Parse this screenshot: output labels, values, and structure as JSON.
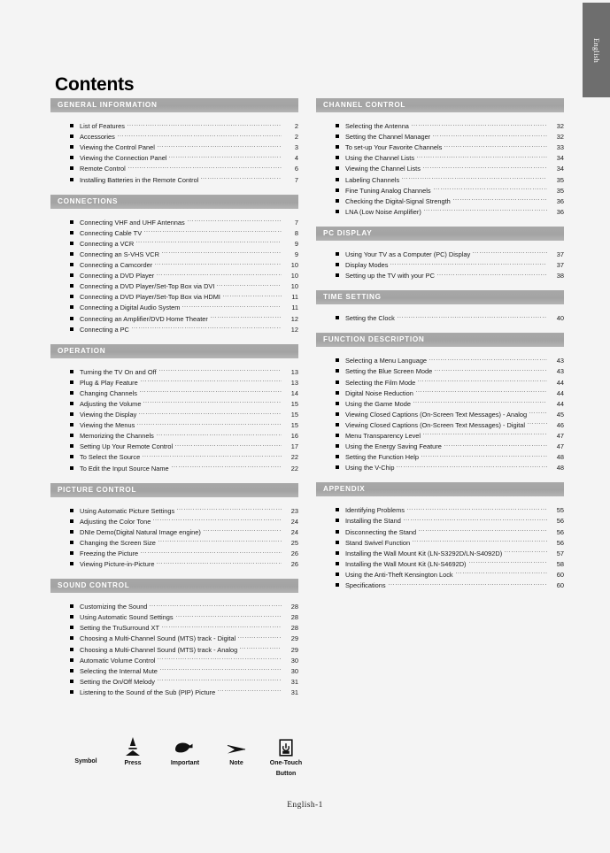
{
  "page": {
    "title": "Contents",
    "footer": "English-1",
    "side_tab_label": "English",
    "accent_header_color": "#a5a5a5",
    "header_text_color": "#ffffff",
    "background_color": "#f4f4f4"
  },
  "columns": {
    "left": [
      {
        "id": "general-information",
        "title": "GENERAL INFORMATION",
        "entries": [
          {
            "label": "List of Features",
            "page": "2"
          },
          {
            "label": "Accessories",
            "page": "2"
          },
          {
            "label": "Viewing the Control Panel",
            "page": "3"
          },
          {
            "label": "Viewing the Connection Panel",
            "page": "4"
          },
          {
            "label": "Remote Control",
            "page": "6"
          },
          {
            "label": "Installing Batteries in the Remote Control",
            "page": "7"
          }
        ]
      },
      {
        "id": "connections",
        "title": "CONNECTIONS",
        "entries": [
          {
            "label": "Connecting VHF and UHF Antennas",
            "page": "7"
          },
          {
            "label": "Connecting Cable TV",
            "page": "8"
          },
          {
            "label": "Connecting a VCR",
            "page": "9"
          },
          {
            "label": "Connecting an S-VHS VCR",
            "page": "9"
          },
          {
            "label": "Connecting a Camcorder",
            "page": "10"
          },
          {
            "label": "Connecting a DVD Player",
            "page": "10"
          },
          {
            "label": "Connecting a DVD Player/Set-Top Box via DVI",
            "page": "10"
          },
          {
            "label": "Connecting a DVD Player/Set-Top Box via HDMI",
            "page": "11"
          },
          {
            "label": "Connecting a Digital Audio System",
            "page": "11"
          },
          {
            "label": "Connecting an Amplifier/DVD Home Theater",
            "page": "12"
          },
          {
            "label": "Connecting a PC",
            "page": "12"
          }
        ]
      },
      {
        "id": "operation",
        "title": "OPERATION",
        "entries": [
          {
            "label": "Turning the TV On and Off",
            "page": "13"
          },
          {
            "label": "Plug & Play Feature",
            "page": "13"
          },
          {
            "label": "Changing Channels",
            "page": "14"
          },
          {
            "label": "Adjusting the Volume",
            "page": "15"
          },
          {
            "label": "Viewing the Display",
            "page": "15"
          },
          {
            "label": "Viewing the Menus",
            "page": "15"
          },
          {
            "label": "Memorizing the Channels",
            "page": "16"
          },
          {
            "label": "Setting Up Your Remote Control",
            "page": "17"
          },
          {
            "label": "To Select the Source",
            "page": "22"
          },
          {
            "label": "To Edit the Input Source Name",
            "page": "22"
          }
        ]
      },
      {
        "id": "picture-control",
        "title": "PICTURE CONTROL",
        "entries": [
          {
            "label": "Using Automatic Picture Settings",
            "page": "23"
          },
          {
            "label": "Adjusting the Color Tone",
            "page": "24"
          },
          {
            "label": "DNIe Demo(Digital Natural Image engine)",
            "page": "24"
          },
          {
            "label": "Changing the Screen Size",
            "page": "25"
          },
          {
            "label": "Freezing the Picture",
            "page": "26"
          },
          {
            "label": "Viewing Picture-in-Picture",
            "page": "26"
          }
        ]
      },
      {
        "id": "sound-control",
        "title": "SOUND CONTROL",
        "entries": [
          {
            "label": "Customizing the Sound",
            "page": "28"
          },
          {
            "label": "Using Automatic Sound Settings",
            "page": "28"
          },
          {
            "label": "Setting the TruSurround XT",
            "page": "28"
          },
          {
            "label": "Choosing a Multi-Channel Sound (MTS) track - Digital",
            "page": "29"
          },
          {
            "label": "Choosing a Multi-Channel Sound (MTS) track - Analog",
            "page": "29"
          },
          {
            "label": "Automatic Volume Control",
            "page": "30"
          },
          {
            "label": "Selecting the Internal Mute",
            "page": "30"
          },
          {
            "label": "Setting the On/Off Melody",
            "page": "31"
          },
          {
            "label": "Listening to the Sound of the Sub (PIP) Picture",
            "page": "31"
          }
        ]
      }
    ],
    "right": [
      {
        "id": "channel-control",
        "title": "CHANNEL CONTROL",
        "entries": [
          {
            "label": "Selecting the Antenna",
            "page": "32"
          },
          {
            "label": "Setting the Channel Manager",
            "page": "32"
          },
          {
            "label": "To set-up Your Favorite Channels",
            "page": "33"
          },
          {
            "label": "Using the Channel Lists",
            "page": "34"
          },
          {
            "label": "Viewing the Channel Lists",
            "page": "34"
          },
          {
            "label": "Labeling Channels",
            "page": "35"
          },
          {
            "label": "Fine Tuning Analog Channels",
            "page": "35"
          },
          {
            "label": "Checking the Digital-Signal Strength",
            "page": "36"
          },
          {
            "label": "LNA (Low Noise Amplifier)",
            "page": "36"
          }
        ]
      },
      {
        "id": "pc-display",
        "title": "PC DISPLAY",
        "entries": [
          {
            "label": "Using Your TV as a Computer (PC) Display",
            "page": "37"
          },
          {
            "label": "Display Modes",
            "page": "37"
          },
          {
            "label": "Setting up the TV with your PC",
            "page": "38"
          }
        ]
      },
      {
        "id": "time-setting",
        "title": "TIME SETTING",
        "entries": [
          {
            "label": "Setting the Clock",
            "page": "40"
          }
        ]
      },
      {
        "id": "function-description",
        "title": "FUNCTION DESCRIPTION",
        "entries": [
          {
            "label": "Selecting a Menu Language",
            "page": "43"
          },
          {
            "label": "Setting the Blue Screen Mode",
            "page": "43"
          },
          {
            "label": "Selecting the Film Mode",
            "page": "44"
          },
          {
            "label": "Digital Noise Reduction",
            "page": "44"
          },
          {
            "label": "Using the Game Mode",
            "page": "44"
          },
          {
            "label": "Viewing Closed Captions (On-Screen Text Messages) - Analog",
            "page": "45"
          },
          {
            "label": "Viewing Closed Captions (On-Screen Text Messages) - Digital",
            "page": "46"
          },
          {
            "label": "Menu Transparency Level",
            "page": "47"
          },
          {
            "label": "Using the Energy Saving Feature",
            "page": "47"
          },
          {
            "label": "Setting the Function Help",
            "page": "48"
          },
          {
            "label": "Using the V-Chip",
            "page": "48"
          }
        ]
      },
      {
        "id": "appendix",
        "title": "APPENDIX",
        "entries": [
          {
            "label": "Identifying Problems",
            "page": "55"
          },
          {
            "label": "Installing the Stand",
            "page": "56"
          },
          {
            "label": "Disconnecting the Stand",
            "page": "56"
          },
          {
            "label": "Stand Swivel Function",
            "page": "56"
          },
          {
            "label": "Installing the Wall Mount Kit (LN-S3292D/LN-S4092D)",
            "page": "57"
          },
          {
            "label": "Installing the Wall Mount Kit (LN-S4692D)",
            "page": "58"
          },
          {
            "label": "Using the Anti-Theft Kensington Lock",
            "page": "60"
          },
          {
            "label": "Specifications",
            "page": "60"
          }
        ]
      }
    ]
  },
  "legend": {
    "symbol_label": "Symbol",
    "items": [
      {
        "icon": "press-arrow-icon",
        "label": "Press"
      },
      {
        "icon": "pointing-hand-icon",
        "label": "Important"
      },
      {
        "icon": "note-arrow-icon",
        "label": "Note"
      },
      {
        "icon": "one-touch-button-icon",
        "label": "One-Touch",
        "label2": "Button"
      }
    ]
  }
}
